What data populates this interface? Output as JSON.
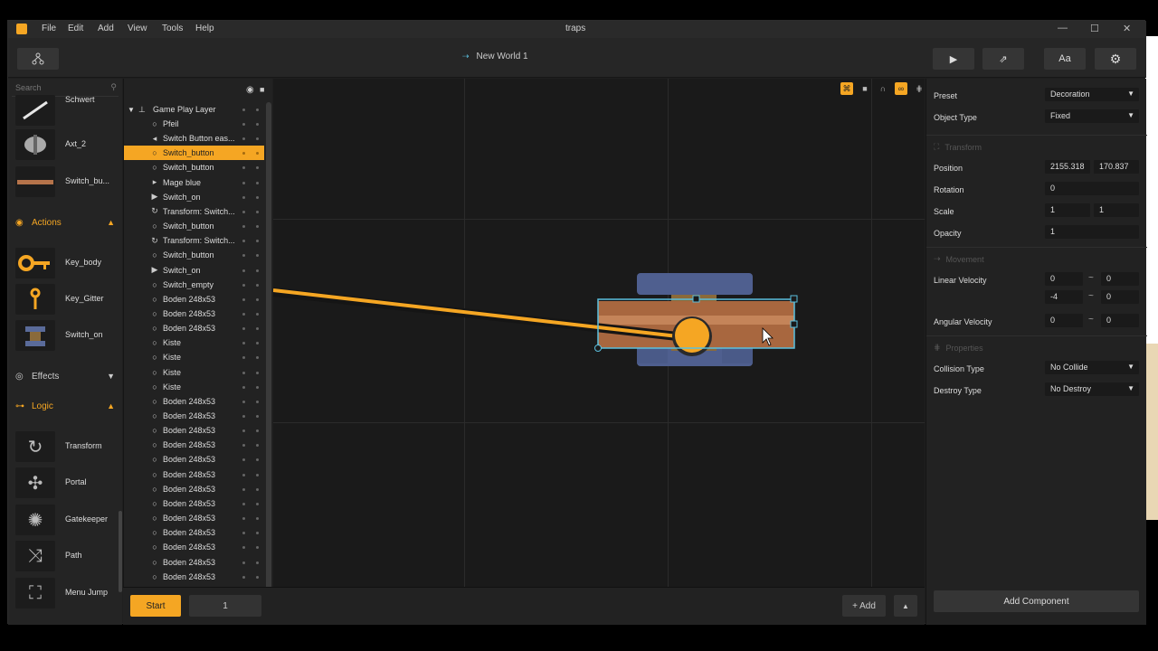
{
  "window": {
    "title": "traps",
    "menu": [
      "File",
      "Edit",
      "Add",
      "View",
      "Tools",
      "Help"
    ],
    "controls": {
      "minimize": "—",
      "maximize": "☐",
      "close": "✕"
    }
  },
  "toolbar": {
    "world_name": "New World 1",
    "play_icon": "▶",
    "share_icon": "⇗",
    "text_button": "Aa",
    "settings_icon": "⚙"
  },
  "palette": {
    "search_placeholder": "Search",
    "items_top": [
      {
        "label": "Schwert",
        "icon": "sword-icon"
      },
      {
        "label": "Axt_2",
        "icon": "axe-icon"
      },
      {
        "label": "Switch_bu...",
        "icon": "plank-icon"
      }
    ],
    "sections": {
      "actions": "Actions",
      "effects": "Effects",
      "logic": "Logic"
    },
    "actions": [
      {
        "label": "Key_body"
      },
      {
        "label": "Key_Gitter"
      },
      {
        "label": "Switch_on"
      }
    ],
    "logic": [
      {
        "label": "Transform"
      },
      {
        "label": "Portal"
      },
      {
        "label": "Gatekeeper"
      },
      {
        "label": "Path"
      },
      {
        "label": "Menu Jump"
      }
    ]
  },
  "layers": {
    "root": "Game Play Layer",
    "rows": [
      {
        "label": "Pfeil",
        "icon": "○"
      },
      {
        "label": "Switch Button eas...",
        "icon": "◂"
      },
      {
        "label": "Switch_button",
        "icon": "○",
        "selected": true
      },
      {
        "label": "Switch_button",
        "icon": "○"
      },
      {
        "label": "Mage blue",
        "icon": "▸"
      },
      {
        "label": "Switch_on",
        "icon": "▶"
      },
      {
        "label": "Transform: Switch...",
        "icon": "↻"
      },
      {
        "label": "Switch_button",
        "icon": "○"
      },
      {
        "label": "Transform: Switch...",
        "icon": "↻"
      },
      {
        "label": "Switch_button",
        "icon": "○"
      },
      {
        "label": "Switch_on",
        "icon": "▶"
      },
      {
        "label": "Switch_empty",
        "icon": "○"
      },
      {
        "label": "Boden 248x53",
        "icon": "○"
      },
      {
        "label": "Boden 248x53",
        "icon": "○"
      },
      {
        "label": "Boden 248x53",
        "icon": "○"
      },
      {
        "label": "Kiste",
        "icon": "○"
      },
      {
        "label": "Kiste",
        "icon": "○"
      },
      {
        "label": "Kiste",
        "icon": "○"
      },
      {
        "label": "Kiste",
        "icon": "○"
      },
      {
        "label": "Boden 248x53",
        "icon": "○"
      },
      {
        "label": "Boden 248x53",
        "icon": "○"
      },
      {
        "label": "Boden 248x53",
        "icon": "○"
      },
      {
        "label": "Boden 248x53",
        "icon": "○"
      },
      {
        "label": "Boden 248x53",
        "icon": "○"
      },
      {
        "label": "Boden 248x53",
        "icon": "○"
      },
      {
        "label": "Boden 248x53",
        "icon": "○"
      },
      {
        "label": "Boden 248x53",
        "icon": "○"
      },
      {
        "label": "Boden 248x53",
        "icon": "○"
      },
      {
        "label": "Boden 248x53",
        "icon": "○"
      },
      {
        "label": "Boden 248x53",
        "icon": "○"
      },
      {
        "label": "Boden 248x53",
        "icon": "○"
      },
      {
        "label": "Boden 248x53",
        "icon": "○"
      }
    ]
  },
  "bottombar": {
    "start_label": "Start",
    "page_value": "1",
    "add_label": "+ Add",
    "up_icon": "▲"
  },
  "inspector": {
    "preset_label": "Preset",
    "preset_value": "Decoration",
    "object_type_label": "Object Type",
    "object_type_value": "Fixed",
    "transform_section": "Transform",
    "position_label": "Position",
    "position_x": "2155.318",
    "position_y": "170.837",
    "rotation_label": "Rotation",
    "rotation_value": "0",
    "scale_label": "Scale",
    "scale_x": "1",
    "scale_y": "1",
    "opacity_label": "Opacity",
    "opacity_value": "1",
    "movement_section": "Movement",
    "linear_velocity_label": "Linear Velocity",
    "lv_x_min": "0",
    "lv_x_max": "0",
    "lv_y_min": "-4",
    "lv_y_max": "0",
    "angular_velocity_label": "Angular Velocity",
    "av_min": "0",
    "av_max": "0",
    "properties_section": "Properties",
    "collision_type_label": "Collision Type",
    "collision_type_value": "No Collide",
    "destroy_type_label": "Destroy Type",
    "destroy_type_value": "No Destroy",
    "tilde": "~",
    "add_component_label": "Add Component"
  },
  "colors": {
    "accent": "#f5a623",
    "panel": "#222222",
    "viewport": "#1a1a1a",
    "selection": "#5bc0de"
  }
}
